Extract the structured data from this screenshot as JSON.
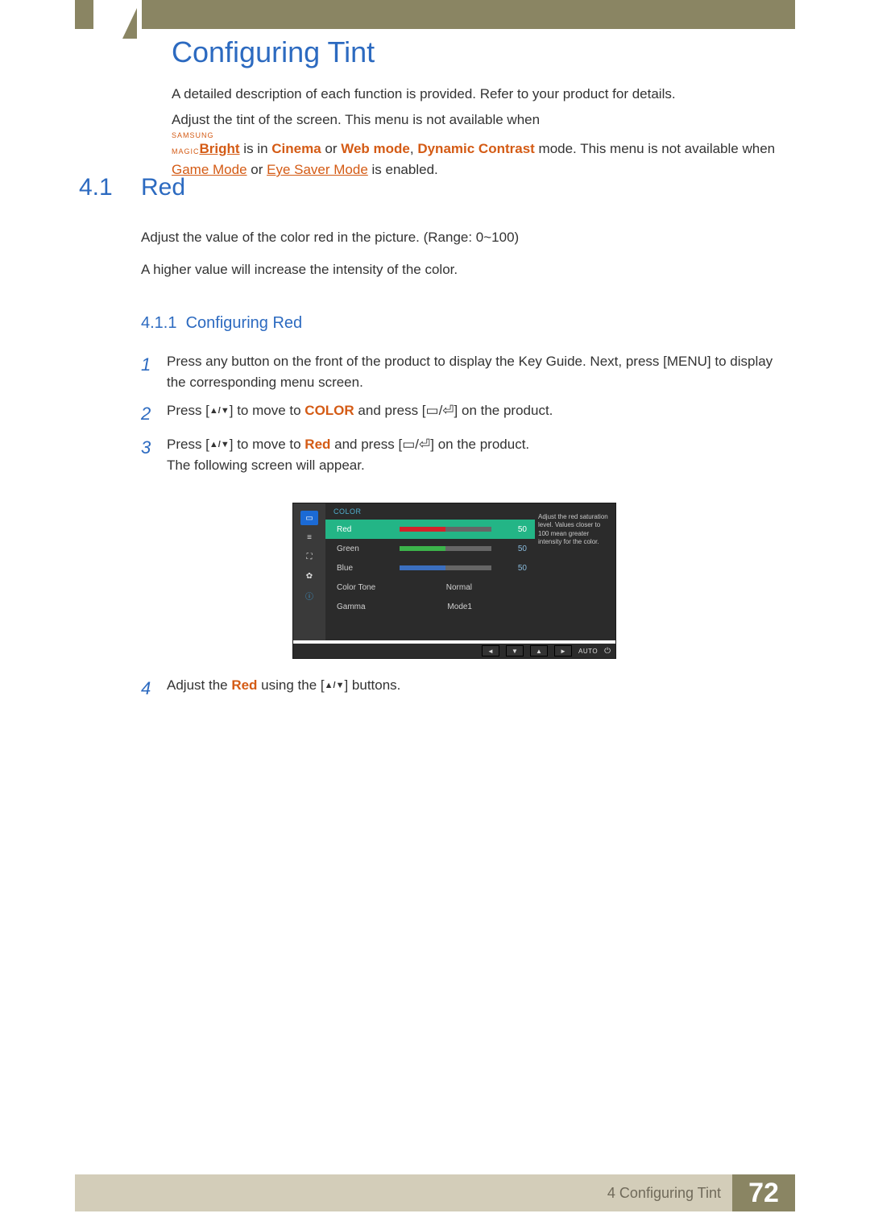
{
  "header": {
    "chapter_title": "Configuring Tint"
  },
  "intro": {
    "line1": "A detailed description of each function is provided. Refer to your product for details.",
    "line2a": "Adjust the tint of the screen. This menu is not available when ",
    "magic_top": "SAMSUNG",
    "magic_bot": "MAGIC",
    "bright": "Bright",
    "line2b": " is in ",
    "cinema": "Cinema",
    "line2c": " or ",
    "webmode": "Web mode",
    "comma": ", ",
    "dc": "Dynamic Contrast",
    "line2d": " mode. This menu is not available when ",
    "game": "Game Mode",
    "or": " or ",
    "eye": "Eye Saver Mode",
    "line2e": " is enabled."
  },
  "section": {
    "num": "4.1",
    "title": "Red",
    "body1": "Adjust the value of the color red in the picture. (Range: 0~100)",
    "body2": "A higher value will increase the intensity of the color."
  },
  "subsection": {
    "num": "4.1.1",
    "title": "Configuring Red"
  },
  "steps": [
    {
      "num": "1",
      "pre": "Press any button on the front of the product to display the Key Guide. Next, press [",
      "menu": "MENU",
      "post": "] to display the corresponding menu screen."
    },
    {
      "num": "2",
      "pre": "Press [",
      "tri": "▲/▼",
      "mid": "] to move to ",
      "target": "COLOR",
      "post1": " and press [",
      "icons": "▭/⏎",
      "post2": "] on the product."
    },
    {
      "num": "3",
      "pre": "Press [",
      "tri": "▲/▼",
      "mid": "] to move to ",
      "target": "Red",
      "post1": " and press [",
      "icons": "▭/⏎",
      "post2": "] on the product.",
      "tail": "The following screen will appear."
    },
    {
      "num": "4",
      "pre": "Adjust the ",
      "target": "Red",
      "mid": " using the [",
      "tri": "▲/▼",
      "post": "] buttons."
    }
  ],
  "osd": {
    "header": "COLOR",
    "rows": [
      {
        "label": "Red",
        "value": "50",
        "bar_color": "#d2232a",
        "selected": true
      },
      {
        "label": "Green",
        "value": "50",
        "bar_color": "#3cb44b"
      },
      {
        "label": "Blue",
        "value": "50",
        "bar_color": "#3b6fbf"
      },
      {
        "label": "Color Tone",
        "text": "Normal"
      },
      {
        "label": "Gamma",
        "text": "Mode1"
      }
    ],
    "desc": "Adjust the red saturation level. Values closer to 100 mean greater intensity for the color.",
    "controls": {
      "auto": "AUTO"
    }
  },
  "footer": {
    "chapter_ref": "4 Configuring Tint",
    "page_number": "72"
  }
}
